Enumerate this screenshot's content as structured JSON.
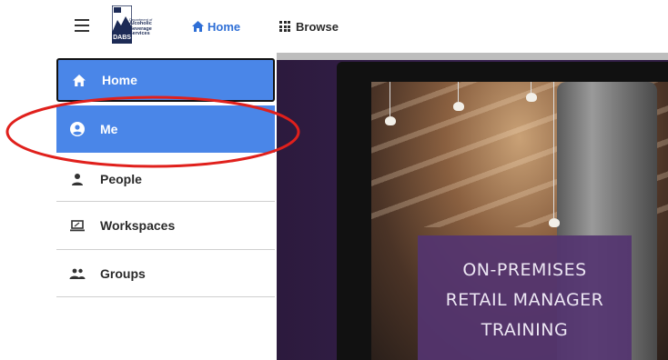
{
  "header": {
    "logo": {
      "line1": "Department of",
      "line2": "Alcoholic",
      "line3": "Beverage",
      "line4": "Services",
      "badge": "DABS"
    },
    "nav": [
      {
        "label": "Home",
        "icon": "home-icon"
      },
      {
        "label": "Browse",
        "icon": "grid-icon"
      }
    ]
  },
  "sidebar": {
    "items": [
      {
        "label": "Home",
        "icon": "home-icon"
      },
      {
        "label": "Me",
        "icon": "account-circle-icon"
      },
      {
        "label": "People",
        "icon": "person-icon"
      },
      {
        "label": "Workspaces",
        "icon": "laptop-icon"
      },
      {
        "label": "Groups",
        "icon": "group-icon"
      }
    ]
  },
  "hero": {
    "caption": [
      "ON-PREMISES",
      "RETAIL MANAGER",
      "TRAINING"
    ]
  },
  "colors": {
    "accent": "#4a86e8",
    "nav_link": "#2f6fd6",
    "annotation": "#e0201c",
    "caption_bg": "#543470"
  }
}
